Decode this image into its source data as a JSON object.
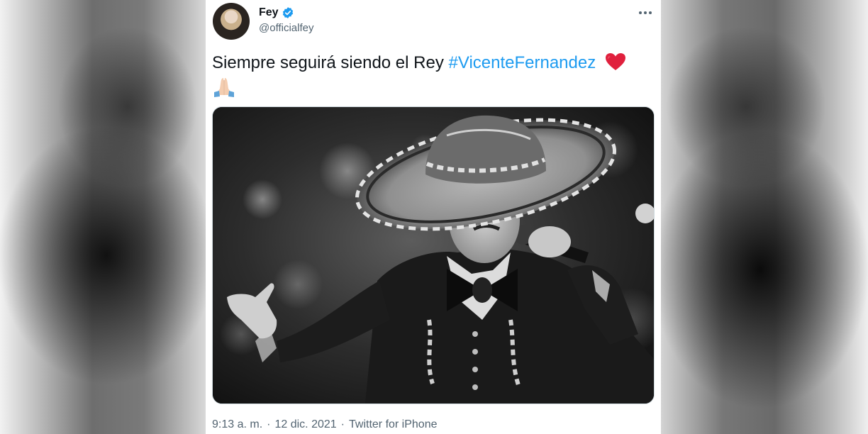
{
  "tweet": {
    "display_name": "Fey",
    "handle": "@officialfey",
    "text_main": "Siempre seguirá siendo el Rey ",
    "hashtag": "#VicenteFernandez",
    "time": "9:13 a. m.",
    "date": "12 dic. 2021",
    "source": "Twitter for iPhone",
    "separator": "·"
  },
  "icons": {
    "verified": "verified-badge-icon",
    "more": "more-options-icon",
    "heart": "red-heart-emoji",
    "pray": "folded-hands-emoji"
  },
  "colors": {
    "link": "#1d9bf0",
    "text": "#0f1419",
    "secondary": "#536471",
    "heart": "#e0203d"
  }
}
